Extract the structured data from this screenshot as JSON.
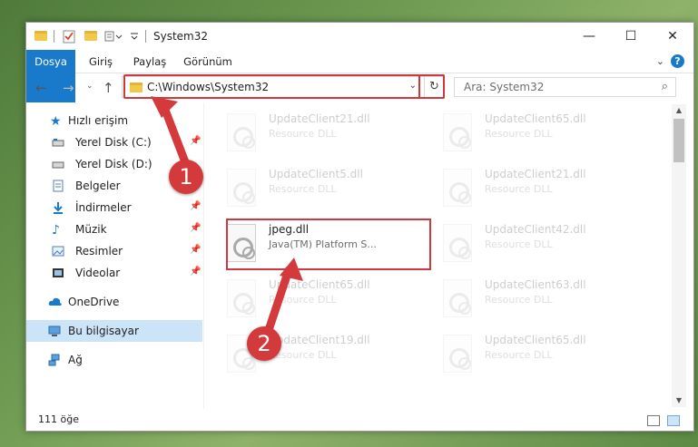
{
  "window": {
    "title": "System32",
    "controls": {
      "minimize": "—",
      "maximize": "☐",
      "close": "✕"
    }
  },
  "ribbon": {
    "tabs": [
      {
        "label": "Dosya",
        "active": true
      },
      {
        "label": "Giriş"
      },
      {
        "label": "Paylaş"
      },
      {
        "label": "Görünüm"
      }
    ],
    "help": "?"
  },
  "address": {
    "path": "C:\\Windows\\System32",
    "search_placeholder": "Ara: System32"
  },
  "navpane": {
    "items": [
      {
        "label": "Hızlı erişim",
        "icon": "star-icon"
      },
      {
        "label": "Yerel Disk (C:)",
        "icon": "drive-icon",
        "pinned": true
      },
      {
        "label": "Yerel Disk (D:)",
        "icon": "drive-icon"
      },
      {
        "label": "Belgeler",
        "icon": "document-icon",
        "pinned": true
      },
      {
        "label": "İndirmeler",
        "icon": "download-icon",
        "pinned": true
      },
      {
        "label": "Müzik",
        "icon": "music-icon",
        "pinned": true
      },
      {
        "label": "Resimler",
        "icon": "picture-icon",
        "pinned": true
      },
      {
        "label": "Videolar",
        "icon": "video-icon",
        "pinned": true
      },
      {
        "label": "OneDrive",
        "icon": "cloud-icon"
      },
      {
        "label": "Bu bilgisayar",
        "icon": "computer-icon",
        "selected": true
      },
      {
        "label": "Ağ",
        "icon": "network-icon"
      }
    ]
  },
  "files": [
    {
      "name": "UpdateClient21.dll",
      "desc": "Resource DLL"
    },
    {
      "name": "UpdateClient65.dll",
      "desc": "Resource DLL"
    },
    {
      "name": "UpdateClient5.dll",
      "desc": "Resource DLL"
    },
    {
      "name": "UpdateClient21.dll",
      "desc": "Resource DLL"
    },
    {
      "name": "jpeg.dll",
      "desc": "Java(TM) Platform S...",
      "highlighted": true
    },
    {
      "name": "UpdateClient42.dll",
      "desc": "Resource DLL"
    },
    {
      "name": "UpdateClient65.dll",
      "desc": "Resource DLL"
    },
    {
      "name": "UpdateClient63.dll",
      "desc": "Resource DLL"
    },
    {
      "name": "UpdateClient19.dll",
      "desc": "Resource DLL"
    },
    {
      "name": "UpdateClient65.dll",
      "desc": "Resource DLL"
    }
  ],
  "status": {
    "count": "111 öğe"
  },
  "annotations": {
    "step1": "1",
    "step2": "2"
  },
  "colors": {
    "accent": "#1979ca",
    "highlight": "#d0393b",
    "selection": "#cce4f7"
  }
}
